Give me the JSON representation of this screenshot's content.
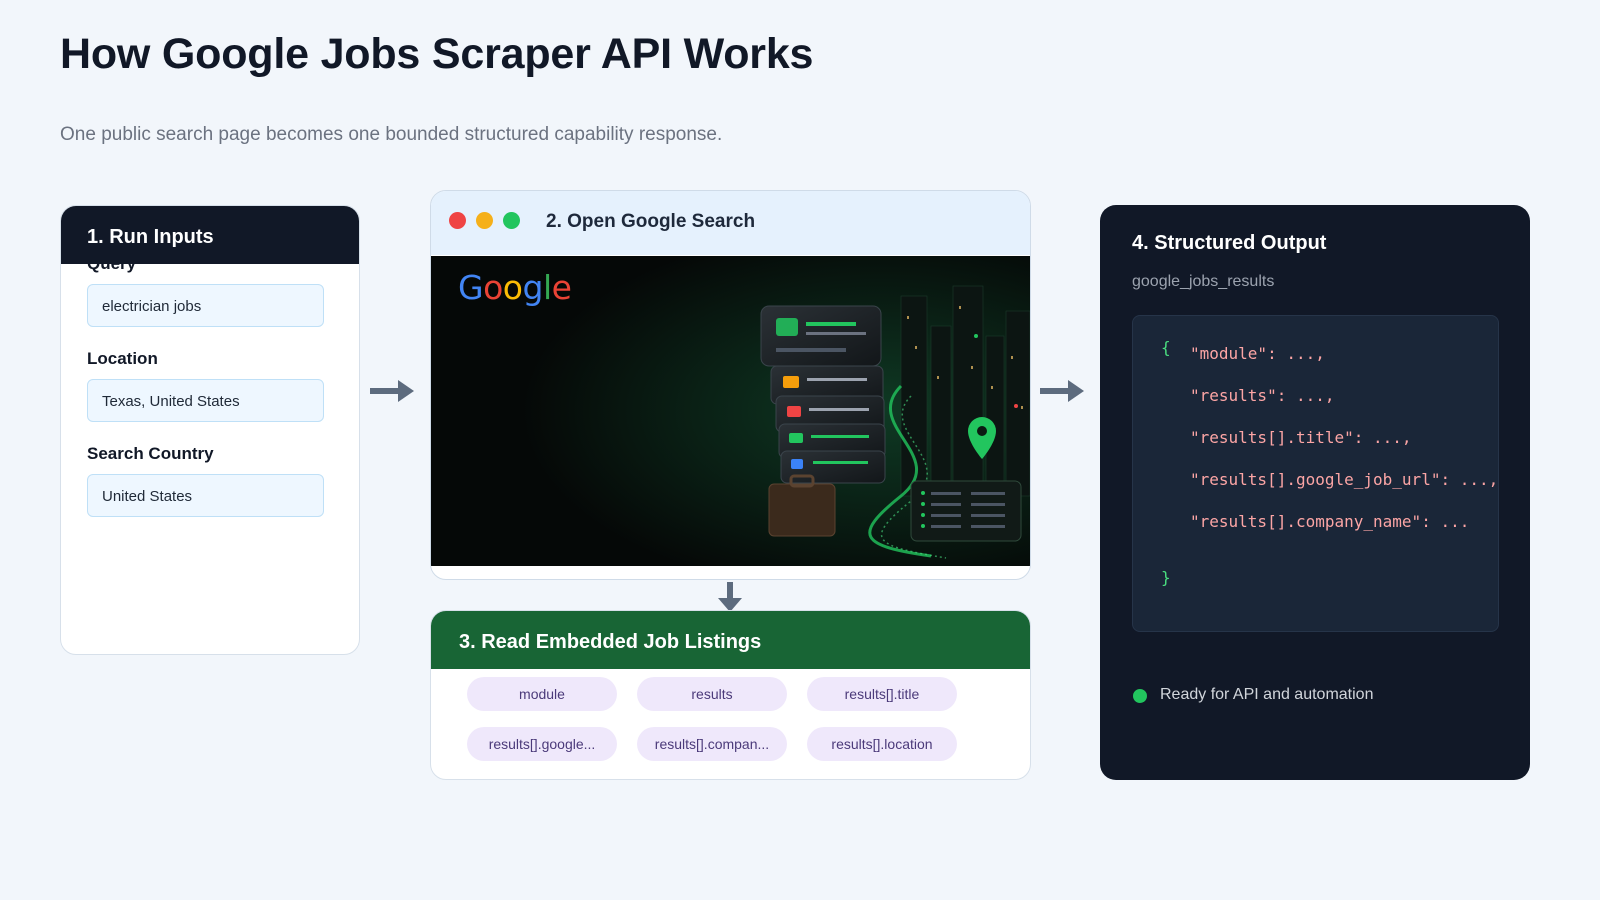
{
  "header": {
    "title": "How Google Jobs Scraper API Works",
    "subtitle": "One public search page becomes one bounded structured capability response."
  },
  "step1": {
    "title": "1. Run Inputs",
    "fields": [
      {
        "label": "Query",
        "value": "electrician jobs"
      },
      {
        "label": "Location",
        "value": "Texas, United States"
      },
      {
        "label": "Search Country",
        "value": "United States"
      }
    ]
  },
  "step2": {
    "title": "2. Open Google Search",
    "logo_text": "Google",
    "window_dots": {
      "red": "#ef4444",
      "yellow": "#f5b01a",
      "green": "#22c55e"
    },
    "logo_colors": [
      "#4285f4",
      "#ea4335",
      "#fbbc05",
      "#4285f4",
      "#34a853",
      "#ea4335"
    ]
  },
  "step3": {
    "title": "3. Read Embedded Job Listings",
    "chips": [
      "module",
      "results",
      "results[].title",
      "results[].google...",
      "results[].compan...",
      "results[].location"
    ]
  },
  "step4": {
    "title": "4. Structured Output",
    "subtitle": "google_jobs_results",
    "code": {
      "open": "{",
      "lines": [
        "\"module\": ...,",
        "\"results\": ...,",
        "\"results[].title\": ...,",
        "\"results[].google_job_url\": ...,",
        "\"results[].company_name\": ..."
      ],
      "close": "}"
    },
    "status": "Ready for API and automation"
  },
  "colors": {
    "dark_panel": "#111827",
    "green_header": "#186535",
    "chip_bg": "#efe8fb",
    "accent_green": "#22c55e",
    "code_key": "#fca5a5"
  }
}
